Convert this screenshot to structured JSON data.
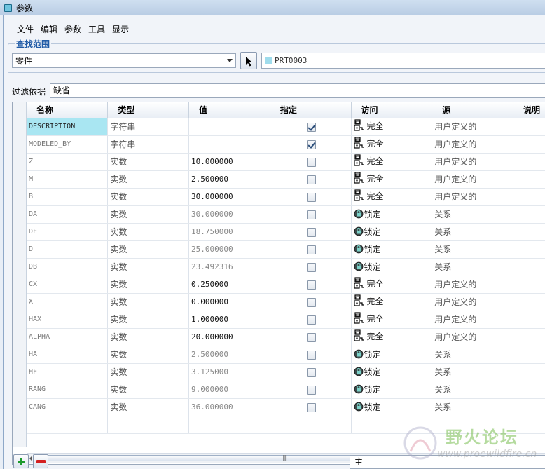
{
  "window": {
    "title": "参数"
  },
  "menu": [
    "文件",
    "编辑",
    "参数",
    "工具",
    "显示"
  ],
  "lookin": {
    "label": "查找范围",
    "scope": "零件",
    "part": "PRT0003"
  },
  "filter": {
    "label": "过滤依据",
    "value": "缺省"
  },
  "columns": [
    "名称",
    "类型",
    "值",
    "指定",
    "访问",
    "源",
    "说明"
  ],
  "rows": [
    {
      "name": "DESCRIPTION",
      "type": "字符串",
      "value": "",
      "designated": true,
      "access": "完全",
      "access_icon": "full-access-icon",
      "source": "用户定义的"
    },
    {
      "name": "MODELED_BY",
      "type": "字符串",
      "value": "",
      "designated": true,
      "access": "完全",
      "access_icon": "full-access-icon",
      "source": "用户定义的"
    },
    {
      "name": "Z",
      "type": "实数",
      "value": "10.000000",
      "designated": false,
      "access": "完全",
      "access_icon": "full-access-icon",
      "source": "用户定义的"
    },
    {
      "name": "M",
      "type": "实数",
      "value": "2.500000",
      "designated": false,
      "access": "完全",
      "access_icon": "full-access-icon",
      "source": "用户定义的"
    },
    {
      "name": "B",
      "type": "实数",
      "value": "30.000000",
      "designated": false,
      "access": "完全",
      "access_icon": "full-access-icon",
      "source": "用户定义的"
    },
    {
      "name": "DA",
      "type": "实数",
      "value": "30.000000",
      "designated": false,
      "access": "锁定",
      "access_icon": "lock-icon",
      "source": "关系"
    },
    {
      "name": "DF",
      "type": "实数",
      "value": "18.750000",
      "designated": false,
      "access": "锁定",
      "access_icon": "lock-icon",
      "source": "关系"
    },
    {
      "name": "D",
      "type": "实数",
      "value": "25.000000",
      "designated": false,
      "access": "锁定",
      "access_icon": "lock-icon",
      "source": "关系"
    },
    {
      "name": "DB",
      "type": "实数",
      "value": "23.492316",
      "designated": false,
      "access": "锁定",
      "access_icon": "lock-icon",
      "source": "关系"
    },
    {
      "name": "CX",
      "type": "实数",
      "value": "0.250000",
      "designated": false,
      "access": "完全",
      "access_icon": "full-access-icon",
      "source": "用户定义的"
    },
    {
      "name": "X",
      "type": "实数",
      "value": "0.000000",
      "designated": false,
      "access": "完全",
      "access_icon": "full-access-icon",
      "source": "用户定义的"
    },
    {
      "name": "HAX",
      "type": "实数",
      "value": "1.000000",
      "designated": false,
      "access": "完全",
      "access_icon": "full-access-icon",
      "source": "用户定义的"
    },
    {
      "name": "ALPHA",
      "type": "实数",
      "value": "20.000000",
      "designated": false,
      "access": "完全",
      "access_icon": "full-access-icon",
      "source": "用户定义的"
    },
    {
      "name": "HA",
      "type": "实数",
      "value": "2.500000",
      "designated": false,
      "access": "锁定",
      "access_icon": "lock-icon",
      "source": "关系"
    },
    {
      "name": "HF",
      "type": "实数",
      "value": "3.125000",
      "designated": false,
      "access": "锁定",
      "access_icon": "lock-icon",
      "source": "关系"
    },
    {
      "name": "RANG",
      "type": "实数",
      "value": "9.000000",
      "designated": false,
      "access": "锁定",
      "access_icon": "lock-icon",
      "source": "关系"
    },
    {
      "name": "CANG",
      "type": "实数",
      "value": "36.000000",
      "designated": false,
      "access": "锁定",
      "access_icon": "lock-icon",
      "source": "关系"
    }
  ],
  "bottom": {
    "set_value": "主"
  },
  "watermark": {
    "text": "野火论坛",
    "url": "www.proewildfire.cn"
  },
  "colors": {
    "selected_cell": "#a9e6f2",
    "group_label": "#1f5aa6",
    "add": "#1c9a2c",
    "delete": "#d42020"
  }
}
